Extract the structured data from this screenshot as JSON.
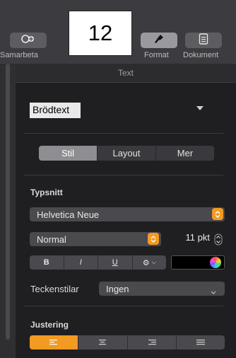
{
  "toolbar": {
    "collaborate_label": "Samarbeta",
    "format_label": "Format",
    "document_label": "Dokument"
  },
  "overlay_number": "12",
  "panel": {
    "title": "Text",
    "paragraph_style": "Brödtext",
    "tabs": [
      {
        "label": "Stil",
        "active": true
      },
      {
        "label": "Layout",
        "active": false
      },
      {
        "label": "Mer",
        "active": false
      }
    ],
    "font_section_label": "Typsnitt",
    "font_family": "Helvetica Neue",
    "font_style": "Normal",
    "font_size": "11 pkt",
    "format_buttons": [
      "B",
      "I",
      "U",
      "⚙"
    ],
    "char_styles_label": "Teckenstilar",
    "char_styles_value": "Ingen",
    "alignment_label": "Justering",
    "text_color": "#000000",
    "accent_color": "#f29a22"
  }
}
